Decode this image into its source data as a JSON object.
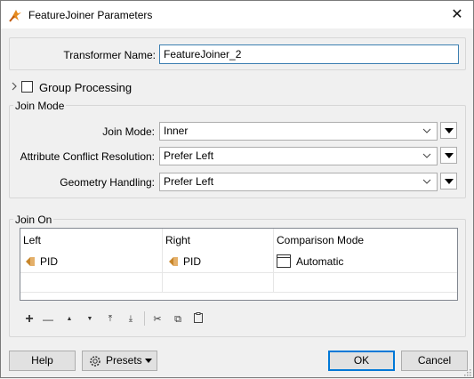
{
  "window": {
    "title": "FeatureJoiner Parameters",
    "close_glyph": "✕"
  },
  "transformer": {
    "label": "Transformer Name:",
    "value": "FeatureJoiner_2"
  },
  "group_processing": {
    "label": "Group Processing",
    "checked": false
  },
  "join_mode_section": {
    "title": "Join Mode",
    "fields": [
      {
        "label": "Join Mode:",
        "value": "Inner"
      },
      {
        "label": "Attribute Conflict Resolution:",
        "value": "Prefer Left"
      },
      {
        "label": "Geometry Handling:",
        "value": "Prefer Left"
      }
    ]
  },
  "join_on": {
    "title": "Join On",
    "columns": [
      "Left",
      "Right",
      "Comparison Mode"
    ],
    "rows": [
      {
        "left": "PID",
        "right": "PID",
        "mode": "Automatic"
      }
    ]
  },
  "toolbar": {
    "add": "+",
    "remove": "—",
    "move_up": "▲",
    "move_down": "▼",
    "move_top": "⤒",
    "move_bottom": "⤓",
    "cut": "✂",
    "copy": "⧉",
    "paste": "📋"
  },
  "buttons": {
    "help": "Help",
    "presets": "Presets",
    "ok": "OK",
    "cancel": "Cancel"
  },
  "colors": {
    "accent": "#0078d7",
    "attr_icon": "#c8862a"
  }
}
